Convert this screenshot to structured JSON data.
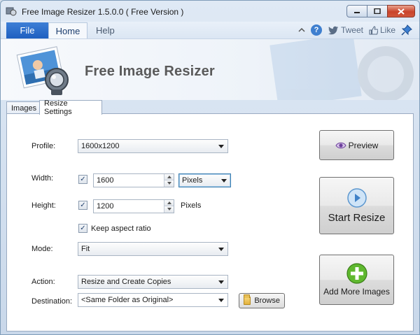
{
  "window": {
    "title": "Free Image Resizer 1.5.0.0 ( Free Version )"
  },
  "ribbon": {
    "tabs": {
      "file": "File",
      "home": "Home",
      "help": "Help"
    },
    "tweet_label": "Tweet",
    "like_label": "Like"
  },
  "banner": {
    "title": "Free Image Resizer"
  },
  "settings_tabs": {
    "images": "Images",
    "resize_settings": "Resize Settings"
  },
  "form": {
    "profile": {
      "label": "Profile:",
      "value": "1600x1200"
    },
    "width": {
      "label": "Width:",
      "checked": true,
      "value": "1600",
      "unit": "Pixels"
    },
    "height": {
      "label": "Height:",
      "checked": true,
      "value": "1200",
      "unit": "Pixels"
    },
    "keep_aspect": {
      "label": "Keep aspect ratio",
      "checked": true
    },
    "mode": {
      "label": "Mode:",
      "value": "Fit"
    },
    "action": {
      "label": "Action:",
      "value": "Resize and Create Copies"
    },
    "destination": {
      "label": "Destination:",
      "value": "<Same Folder as Original>",
      "browse_label": "Browse"
    }
  },
  "buttons": {
    "preview": "Preview",
    "start_resize": "Start Resize",
    "add_more_images": "Add More Images"
  }
}
